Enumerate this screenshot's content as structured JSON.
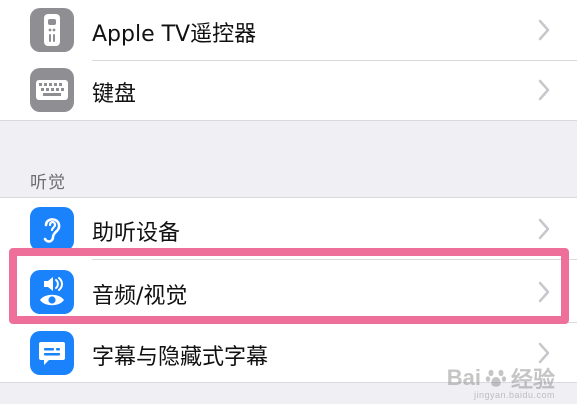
{
  "rows": [
    {
      "label": "Apple TV遥控器",
      "icon": "remote-icon",
      "icon_color": "#8e8e93"
    },
    {
      "label": "键盘",
      "icon": "keyboard-icon",
      "icon_color": "#8e8e93"
    },
    {
      "label": "助听设备",
      "icon": "ear-icon",
      "icon_color": "#1a82fb"
    },
    {
      "label": "音频/视觉",
      "icon": "audio-visual-icon",
      "icon_color": "#1a82fb"
    },
    {
      "label": "字幕与隐藏式字幕",
      "icon": "captions-icon",
      "icon_color": "#1a82fb"
    }
  ],
  "section_header": "听觉",
  "highlight_color": "#ee6f9a",
  "watermark": {
    "brand": "Bai",
    "brand_suffix": "经验",
    "url": "jingyan.baidu.com"
  }
}
